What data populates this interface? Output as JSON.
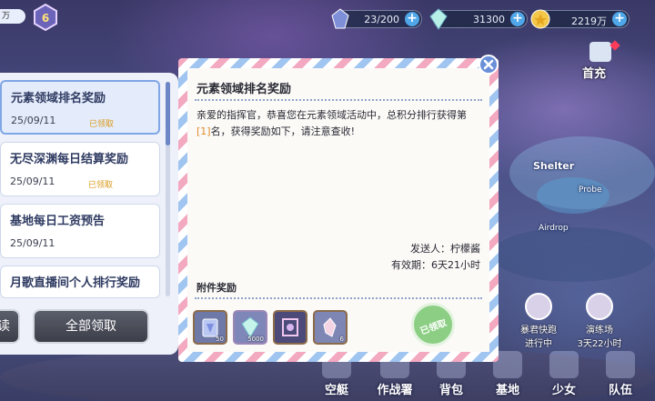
{
  "hud": {
    "wan_label": "万",
    "rank_number": "6",
    "resources": [
      {
        "icon": "stamina-crystal-icon",
        "value": "23/200"
      },
      {
        "icon": "gem-icon",
        "value": "31300"
      },
      {
        "icon": "gold-coin-icon",
        "value": "2219万"
      }
    ]
  },
  "side_buttons": {
    "first_charge_label": "首充"
  },
  "map": {
    "shelter_label": "Shelter",
    "airdrop_label": "Airdrop",
    "probe_label": "Probe",
    "chars": [
      {
        "name": "暴君快跑",
        "status": "进行中"
      },
      {
        "name": "演练场",
        "status": "3天22小时"
      }
    ]
  },
  "bottom_nav": [
    {
      "label": "空艇",
      "icon": "airship-icon"
    },
    {
      "label": "作战署",
      "icon": "combat-icon"
    },
    {
      "label": "背包",
      "icon": "backpack-icon"
    },
    {
      "label": "基地",
      "icon": "base-icon"
    },
    {
      "label": "少女",
      "icon": "girl-icon"
    },
    {
      "label": "队伍",
      "icon": "team-icon"
    }
  ],
  "mail_list": [
    {
      "title": "元素领域排名奖励",
      "date": "25/09/11",
      "status": "已领取",
      "active": true
    },
    {
      "title": "无尽深渊每日结算奖励",
      "date": "25/09/11",
      "status": "已领取",
      "active": false
    },
    {
      "title": "基地每日工资预告",
      "date": "25/09/11",
      "status": "",
      "active": false
    },
    {
      "title": "月歌直播间个人排行奖励",
      "date": "",
      "status": "",
      "active": false
    }
  ],
  "buttons": {
    "read_label": "读",
    "claim_all_label": "全部领取"
  },
  "letter": {
    "title": "元素领域排名奖励",
    "body_prefix": "亲爱的指挥官，恭喜您在元素领域活动中，总积分排行获得第",
    "body_highlight": "[1]",
    "body_suffix": "名，获得奖励如下，请注意查收!",
    "sender": "发送人：柠檬酱",
    "validity": "有效期：6天21小时",
    "attachments_title": "附件奖励",
    "attachments": [
      {
        "icon": "crystal-card-icon",
        "qty": "50"
      },
      {
        "icon": "gem-icon",
        "qty": "5000"
      },
      {
        "icon": "frame-item-icon",
        "qty": ""
      },
      {
        "icon": "crystal-shard-icon",
        "qty": "6"
      }
    ],
    "stamp_label": "已领取"
  },
  "colors": {
    "accent_blue": "#7fa6e6",
    "claimed_orange": "#d99a1b",
    "stamp_green": "#8ccf84",
    "stripe_pink": "#f3a9c0",
    "stripe_blue": "#9fc5f0"
  }
}
